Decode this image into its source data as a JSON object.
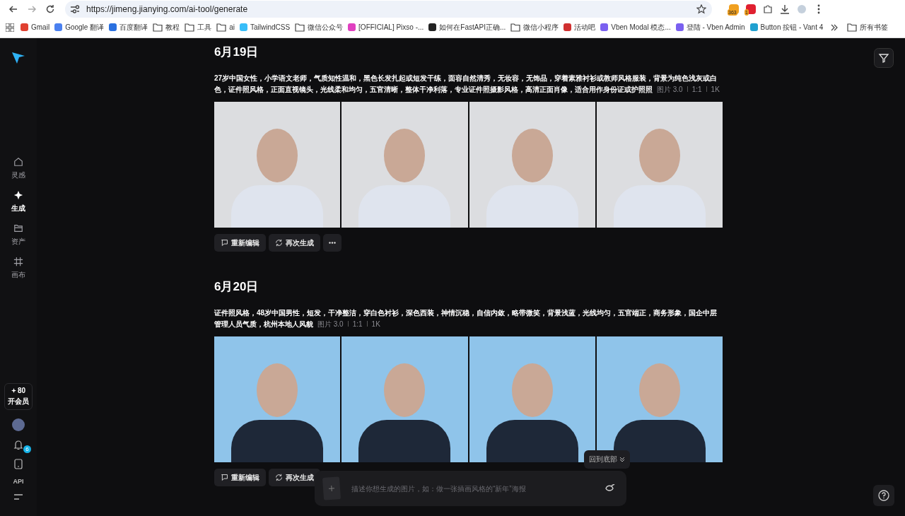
{
  "browser": {
    "url": "https://jimeng.jianying.com/ai-tool/generate",
    "bookmarks": [
      {
        "label": "Gmail",
        "kind": "site"
      },
      {
        "label": "Google 翻译",
        "kind": "site"
      },
      {
        "label": "百度翻译",
        "kind": "site"
      },
      {
        "label": "教程",
        "kind": "folder"
      },
      {
        "label": "工具",
        "kind": "folder"
      },
      {
        "label": "ai",
        "kind": "folder"
      },
      {
        "label": "TailwindCSS",
        "kind": "site"
      },
      {
        "label": "微信公众号",
        "kind": "folder"
      },
      {
        "label": "[OFFICIAL] Pixso -...",
        "kind": "site"
      },
      {
        "label": "如何在FastAPI正确...",
        "kind": "site"
      },
      {
        "label": "微信小程序",
        "kind": "folder"
      },
      {
        "label": "活动吧",
        "kind": "site"
      },
      {
        "label": "Vben Modal 模态...",
        "kind": "site"
      },
      {
        "label": "登陆 - Vben Admin",
        "kind": "site"
      },
      {
        "label": "Button 按钮 - Vant 4",
        "kind": "site"
      }
    ],
    "all_bookmarks": "所有书签",
    "extension_badges": [
      "363",
      "1"
    ]
  },
  "sidebar": {
    "items": [
      {
        "label": "灵感",
        "kind": "home",
        "selected": false
      },
      {
        "label": "生成",
        "kind": "generate",
        "selected": true
      },
      {
        "label": "资产",
        "kind": "assets",
        "selected": false
      },
      {
        "label": "画布",
        "kind": "canvas",
        "selected": false
      }
    ],
    "credits": "80",
    "membership": "开会员",
    "notifications": "6",
    "api": "API"
  },
  "sections": [
    {
      "date": "6月19日",
      "prompt": "27岁中国女性，小学语文老师，气质知性温和，黑色长发扎起或短发干练，面容自然清秀，无妆容，无饰品，穿着素雅衬衫或教师风格服装，背景为纯色浅灰或白色，证件照风格，正面直视镜头，光线柔和均匀，五官清晰，整体干净利落，专业证件照摄影风格，高清正面肖像，适合用作身份证或护照照",
      "meta": [
        "图片 3.0",
        "1:1",
        "1K"
      ],
      "actions": [
        "重新编辑",
        "再次生成"
      ],
      "more_menu": true
    },
    {
      "date": "6月20日",
      "prompt": "证件照风格，48岁中国男性，短发，干净整洁，穿白色衬衫，深色西装，神情沉稳，自信内敛，略带微笑，背景浅蓝，光线均匀，五官端正，商务形象，国企中层管理人员气质，杭州本地人风貌",
      "meta": [
        "图片 3.0",
        "1:1",
        "1K"
      ],
      "actions": [
        "重新编辑",
        "再次生成"
      ],
      "more_menu": false
    }
  ],
  "back_to_bottom": "回到底部",
  "composer": {
    "placeholder": "描述你想生成的图片，如：做一张插画风格的“新年”海报"
  }
}
